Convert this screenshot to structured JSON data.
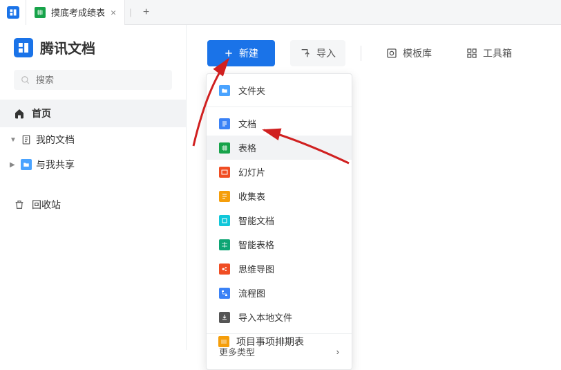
{
  "tab": {
    "title": "摸底考成绩表"
  },
  "brand": {
    "name": "腾讯文档"
  },
  "search": {
    "placeholder": "搜索"
  },
  "sidebar": {
    "home": "首页",
    "mydocs": "我的文档",
    "shared": "与我共享",
    "trash": "回收站"
  },
  "toolbar": {
    "new": "新建",
    "import": "导入",
    "templates": "模板库",
    "toolbox": "工具箱"
  },
  "dropdown": {
    "items": [
      {
        "label": "文件夹",
        "icon": "folder",
        "color": "#4aa3ff"
      },
      {
        "label": "文档",
        "icon": "doc",
        "color": "#3b82f6"
      },
      {
        "label": "表格",
        "icon": "sheet",
        "color": "#17a34a"
      },
      {
        "label": "幻灯片",
        "icon": "slide",
        "color": "#f04d23"
      },
      {
        "label": "收集表",
        "icon": "collect",
        "color": "#f59e0b"
      },
      {
        "label": "智能文档",
        "icon": "smartdoc",
        "color": "#11c7d9"
      },
      {
        "label": "智能表格",
        "icon": "smartsheet",
        "color": "#0ea574"
      },
      {
        "label": "思维导图",
        "icon": "mindmap",
        "color": "#f04d23"
      },
      {
        "label": "流程图",
        "icon": "flow",
        "color": "#3b82f6"
      },
      {
        "label": "导入本地文件",
        "icon": "import",
        "color": "#555"
      }
    ],
    "more": "更多类型"
  },
  "belowItem": {
    "label": "项目事项排期表"
  }
}
